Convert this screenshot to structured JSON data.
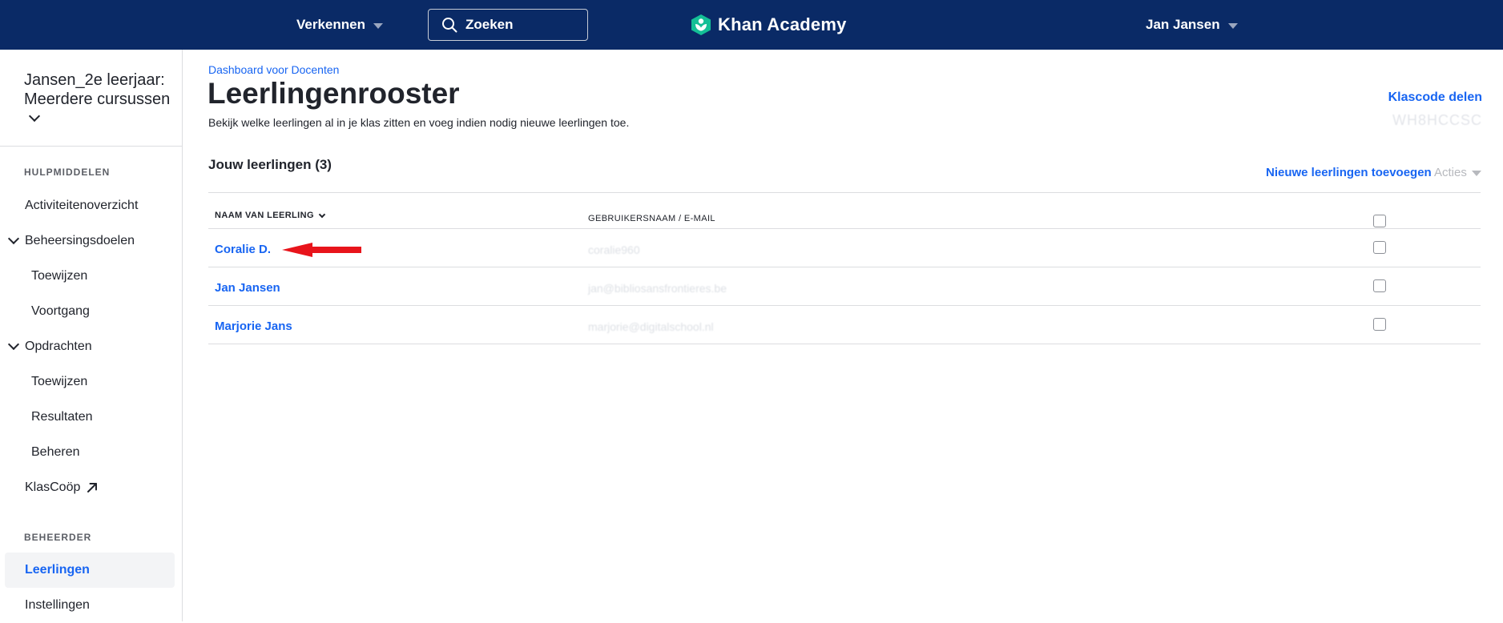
{
  "nav": {
    "explore_label": "Verkennen",
    "search_placeholder": "Zoeken",
    "brand": "Khan Academy",
    "user_name": "Jan Jansen"
  },
  "colors": {
    "nav_bg": "#0a2a66",
    "link_blue": "#1865f2",
    "brand_green": "#14bf96",
    "annotation_red": "#e8141b"
  },
  "sidebar": {
    "class_title": "Jansen_2e leerjaar: Meerdere cursussen",
    "section_tools": "HULPMIDDELEN",
    "section_admin": "BEHEERDER",
    "items": {
      "activity": "Activiteitenoverzicht",
      "mastery": "Beheersingsdoelen",
      "mastery_assign": "Toewijzen",
      "mastery_progress": "Voortgang",
      "assignments": "Opdrachten",
      "assignments_assign": "Toewijzen",
      "assignments_results": "Resultaten",
      "assignments_manage": "Beheren",
      "klascoop": "KlasCoöp",
      "students": "Leerlingen",
      "settings": "Instellingen"
    }
  },
  "main": {
    "breadcrumb": "Dashboard voor Docenten",
    "title": "Leerlingenrooster",
    "subtitle": "Bekijk welke leerlingen al in je klas zitten en voeg indien nodig nieuwe leerlingen toe.",
    "share_code_label": "Klascode delen",
    "class_code": "WH8HCCSC",
    "students_heading": "Jouw leerlingen (3)",
    "add_students_label": "Nieuwe leerlingen toevoegen",
    "actions_label": "Acties",
    "columns": {
      "name": "NAAM VAN LEERLING",
      "username": "GEBRUIKERSNAAM / E-MAIL"
    },
    "students": [
      {
        "name": "Coralie D.",
        "username": "coralie960"
      },
      {
        "name": "Jan Jansen",
        "username": "jan@bibliosansfrontieres.be"
      },
      {
        "name": "Marjorie Jans",
        "username": "marjorie@digitalschool.nl"
      }
    ]
  }
}
